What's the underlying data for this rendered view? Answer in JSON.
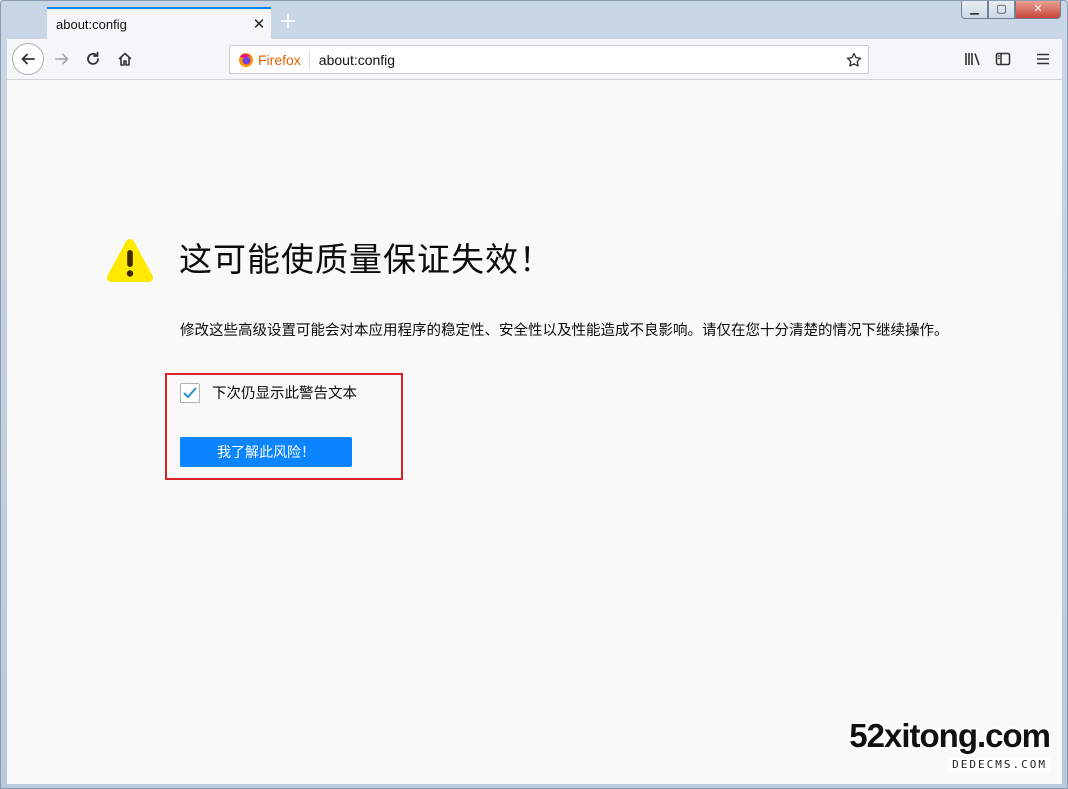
{
  "tab": {
    "title": "about:config"
  },
  "urlbar": {
    "identity_label": "Firefox",
    "url": "about:config"
  },
  "colors": {
    "accent": "#0a84ff",
    "warning": "#ffe900",
    "highlight_border": "#d9222a",
    "identity": "#e66000"
  },
  "warning": {
    "title": "这可能使质量保证失效！",
    "description": "修改这些高级设置可能会对本应用程序的稳定性、安全性以及性能造成不良影响。请仅在您十分清楚的情况下继续操作。",
    "checkbox_label": "下次仍显示此警告文本",
    "checkbox_checked": true,
    "accept_button": "我了解此风险！"
  },
  "watermark": {
    "main": "52xitong.com",
    "sub": "DEDECMS.COM"
  },
  "icons": {
    "back": "back-arrow-icon",
    "forward": "forward-arrow-icon",
    "reload": "reload-icon",
    "home": "home-icon",
    "star": "bookmark-star-icon",
    "library": "library-icon",
    "sidebar": "sidebar-icon",
    "menu": "hamburger-menu-icon",
    "warning": "warning-triangle-icon"
  }
}
